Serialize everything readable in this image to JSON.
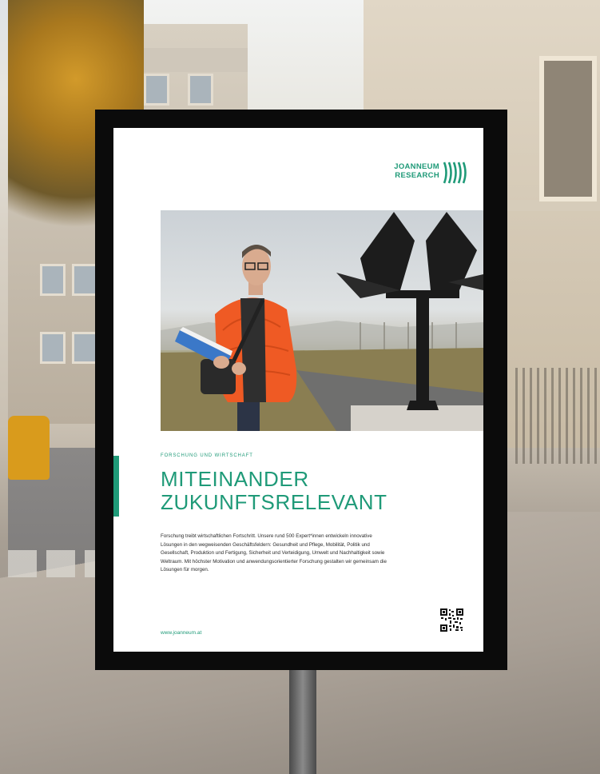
{
  "scene": {
    "description_colors": {
      "accent": "#1f9a78",
      "frame": "#0b0b0b",
      "jacket": "#ef5a24"
    }
  },
  "poster": {
    "logo": {
      "line1": "JOANNEUM",
      "line2": "RESEARCH",
      "icon": "stripes-logo-icon"
    },
    "eyebrow": "FORSCHUNG UND WIRTSCHAFT",
    "headline_line1": "MITEINANDER",
    "headline_line2": "ZUKUNFTSRELEVANT",
    "body": "Forschung treibt wirtschaftlichen Fortschritt. Unsere rund 500 Expert*innen entwickeln innovative Lösungen in den wegweisenden Geschäftsfeldern: Gesundheit und Pflege, Mobilität, Politik und Gesellschaft, Produktion und Fertigung, Sicherheit und Verteidigung, Umwelt und Nachhaltigkeit sowie Weltraum. Mit höchster Motivation und anwendungsorientierter Forschung gestalten wir gemeinsam die Lösungen für morgen.",
    "url": "www.joanneum.at",
    "qr_icon": "qr-code-icon"
  }
}
